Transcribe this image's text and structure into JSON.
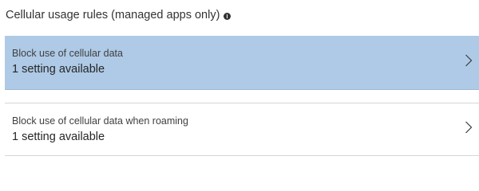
{
  "section": {
    "title": "Cellular usage rules (managed apps only)",
    "info_icon": "info-icon"
  },
  "rows": [
    {
      "label": "Block use of cellular data",
      "value": "1 setting available",
      "selected": true,
      "icon": "chevron-right-icon"
    },
    {
      "label": "Block use of cellular data when roaming",
      "value": "1 setting available",
      "selected": false,
      "icon": "chevron-right-icon"
    }
  ],
  "colors": {
    "selected_row_bg": "#aecae6",
    "divider": "#d6d6d6",
    "text": "#262626"
  }
}
